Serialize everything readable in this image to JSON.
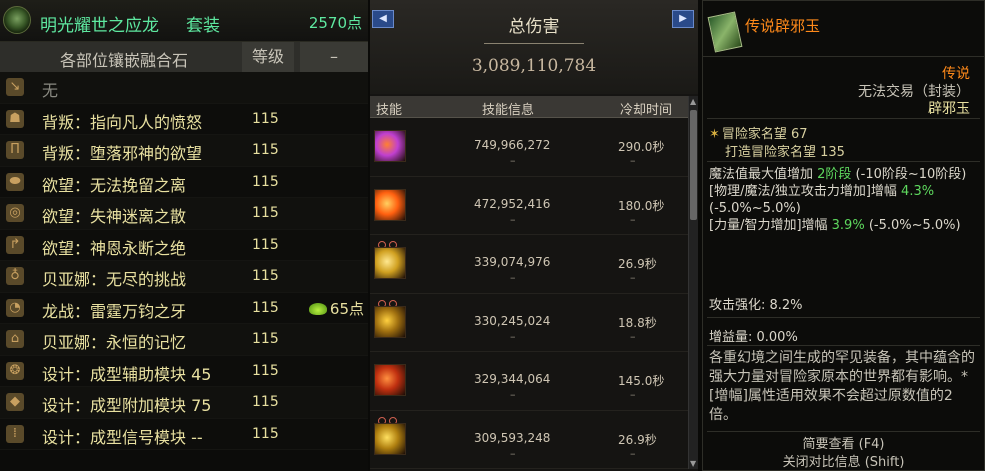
{
  "set": {
    "name": "明光耀世之应龙",
    "type": "套装",
    "points": "2570点"
  },
  "columns": {
    "slot": "各部位镶嵌融合石",
    "level": "等级",
    "extra": "–"
  },
  "slots": [
    {
      "icon": "shoulder-icon",
      "name": "无",
      "level": "",
      "extra": ""
    },
    {
      "icon": "top-icon",
      "name": "背叛：指向凡人的愤怒",
      "level": "115",
      "extra": ""
    },
    {
      "icon": "pants-icon",
      "name": "背叛：堕落邪神的欲望",
      "level": "115",
      "extra": ""
    },
    {
      "icon": "belt-icon",
      "name": "欲望：无法挽留之离",
      "level": "115",
      "extra": ""
    },
    {
      "icon": "ring-icon",
      "name": "欲望：失神迷离之散",
      "level": "115",
      "extra": ""
    },
    {
      "icon": "bracelet-icon",
      "name": "欲望：神恩永断之绝",
      "level": "115",
      "extra": ""
    },
    {
      "icon": "necklace-icon",
      "name": "贝亚娜：无尽的挑战",
      "level": "115",
      "extra": ""
    },
    {
      "icon": "ring2-icon",
      "name": "龙战：雷霆万钧之牙",
      "level": "115",
      "extra": "65点"
    },
    {
      "icon": "earring-icon",
      "name": "贝亚娜：永恒的记忆",
      "level": "115",
      "extra": ""
    },
    {
      "icon": "aux-icon",
      "name": "设计：成型辅助模块 45",
      "level": "115",
      "extra": ""
    },
    {
      "icon": "gem-icon",
      "name": "设计：成型附加模块 75",
      "level": "115",
      "extra": ""
    },
    {
      "icon": "signal-icon",
      "name": "设计：成型信号模块 --",
      "level": "115",
      "extra": ""
    }
  ],
  "damage": {
    "title": "总伤害",
    "total": "3,089,110,784",
    "headers": {
      "skill": "技能",
      "info": "技能信息",
      "cooldown": "冷却时间"
    },
    "skills": [
      {
        "icon": "skill-purple-burst-icon",
        "color1": "#c040d0",
        "color2": "#ff8030",
        "damage": "749,966,272",
        "cooldown": "290.0秒",
        "badges": false
      },
      {
        "icon": "skill-orange-slash-icon",
        "color1": "#ff6010",
        "color2": "#ffd060",
        "damage": "472,952,416",
        "cooldown": "180.0秒",
        "badges": false
      },
      {
        "icon": "skill-gold-sword-icon",
        "color1": "#d0a020",
        "color2": "#ffe890",
        "damage": "339,074,976",
        "cooldown": "26.9秒",
        "badges": true
      },
      {
        "icon": "skill-gold-ring-icon",
        "color1": "#a07010",
        "color2": "#ffd040",
        "damage": "330,245,024",
        "cooldown": "18.8秒",
        "badges": true
      },
      {
        "icon": "skill-fire-armor-icon",
        "color1": "#c03010",
        "color2": "#ff9040",
        "damage": "329,344,064",
        "cooldown": "145.0秒",
        "badges": false
      },
      {
        "icon": "skill-gold-wave-icon",
        "color1": "#b08010",
        "color2": "#ffe060",
        "damage": "309,593,248",
        "cooldown": "26.9秒",
        "badges": true
      }
    ]
  },
  "item": {
    "name": "传说辟邪玉",
    "rarity": "传说",
    "trade": "无法交易（封装）",
    "subtype": "辟邪玉",
    "fame": "冒险家名望 67",
    "fame2": "打造冒险家名望 135",
    "stat1_a": "魔法值最大值增加 ",
    "stat1_b": "2阶段",
    "stat1_c": " (-10阶段~10阶段)",
    "stat2_a": "[物理/魔法/独立攻击力增加]增幅 ",
    "stat2_b": "4.3%",
    "stat2_c": " (-5.0%~5.0%)",
    "stat3_a": "[力量/智力增加]增幅 ",
    "stat3_b": "3.9%",
    "stat3_c": " (-5.0%~5.0%)",
    "attack": "攻击强化: 8.2%",
    "buff": "增益量: 0.00%",
    "flavor": "各重幻境之间生成的罕见装备，其中蕴含的强大力量对冒险家原本的世界都有影响。*[增幅]属性适用效果不会超过原数值的2倍。",
    "hint1": "简要查看 (F4)",
    "hint2": "关闭对比信息 (Shift)",
    "colors": {
      "legend": "#ff8a1a",
      "green": "#5ed85e"
    }
  }
}
